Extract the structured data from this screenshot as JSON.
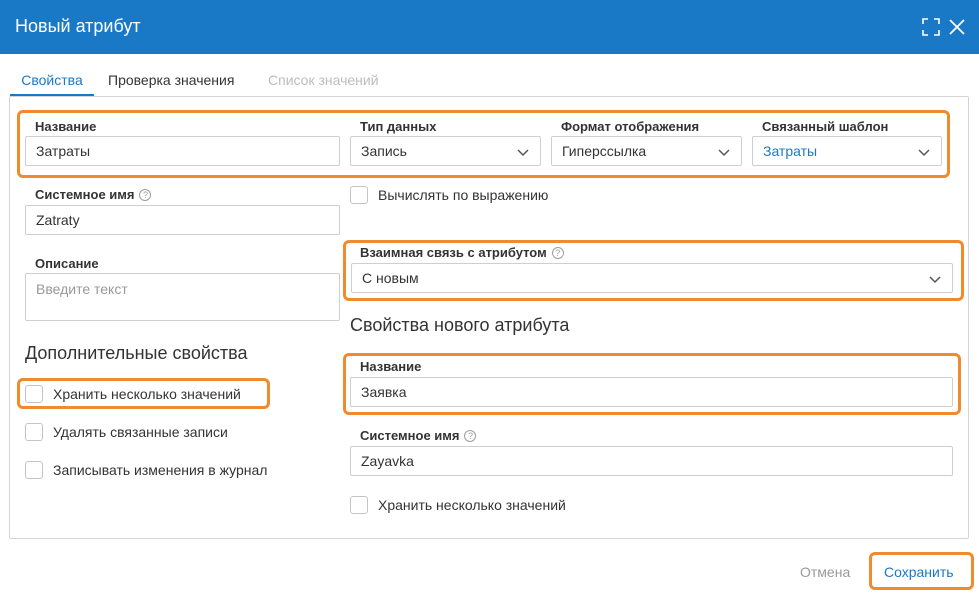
{
  "window": {
    "title": "Новый атрибут"
  },
  "tabs": [
    {
      "label": "Свойства",
      "state": "active"
    },
    {
      "label": "Проверка значения",
      "state": "normal"
    },
    {
      "label": "Список значений",
      "state": "disabled"
    }
  ],
  "form": {
    "name": {
      "label": "Название",
      "value": "Затраты"
    },
    "data_type": {
      "label": "Тип данных",
      "value": "Запись"
    },
    "display_format": {
      "label": "Формат отображения",
      "value": "Гиперссылка"
    },
    "linked_template": {
      "label": "Связанный шаблон",
      "value": "Затраты"
    },
    "system_name": {
      "label": "Системное имя",
      "value": "Zatraty"
    },
    "compute_by_expression": {
      "label": "Вычислять по выражению",
      "checked": false
    },
    "description": {
      "label": "Описание",
      "placeholder": "Введите текст"
    },
    "mutual_link": {
      "label": "Взаимная связь с атрибутом",
      "value": "С новым"
    }
  },
  "additional": {
    "title": "Дополнительные свойства",
    "store_multiple": {
      "label": "Хранить несколько значений",
      "checked": false
    },
    "delete_linked": {
      "label": "Удалять связанные записи",
      "checked": false
    },
    "log_changes": {
      "label": "Записывать изменения в журнал",
      "checked": false
    }
  },
  "new_attribute": {
    "title": "Свойства нового атрибута",
    "name": {
      "label": "Название",
      "value": "Заявка"
    },
    "system_name": {
      "label": "Системное имя",
      "value": "Zayavka"
    },
    "store_multiple": {
      "label": "Хранить несколько значений",
      "checked": false
    }
  },
  "footer": {
    "cancel_label": "Отмена",
    "save_label": "Сохранить"
  },
  "colors": {
    "accent": "#1a79c6",
    "highlight": "#f08a2e"
  }
}
